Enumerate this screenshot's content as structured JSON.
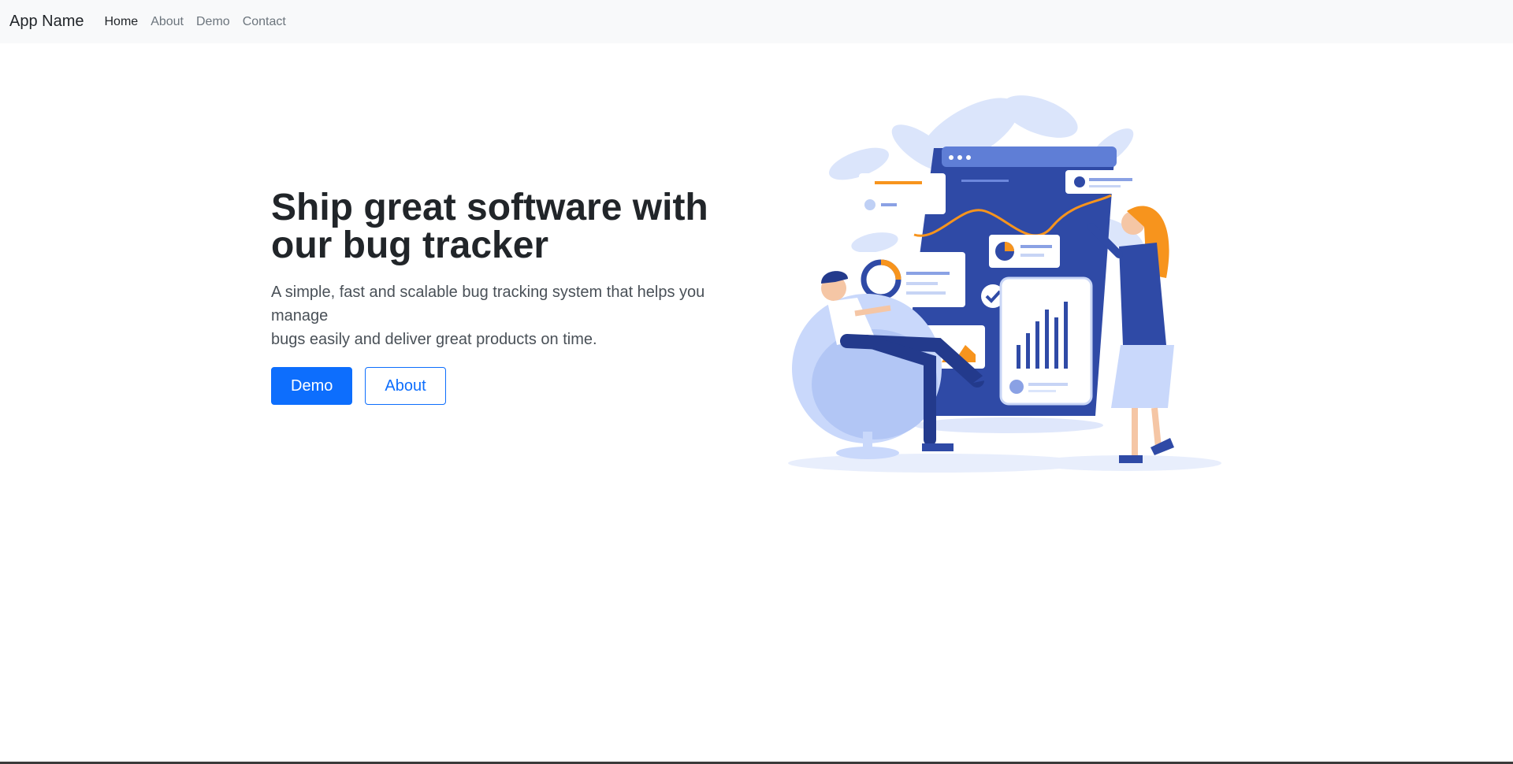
{
  "navbar": {
    "brand": "App Name",
    "links": [
      {
        "label": "Home",
        "active": true
      },
      {
        "label": "About",
        "active": false
      },
      {
        "label": "Demo",
        "active": false
      },
      {
        "label": "Contact",
        "active": false
      }
    ]
  },
  "hero": {
    "title_line1": "Ship great software with",
    "title_line2": "our bug tracker",
    "lead_line1": "A simple, fast and scalable bug tracking system that helps you manage",
    "lead_line2": "bugs easily and deliver great products on time.",
    "primary_button": "Demo",
    "secondary_button": "About"
  },
  "illustration": {
    "icon": "team-analytics-dashboard-illustration"
  },
  "colors": {
    "primary": "#0d6efd",
    "nav_bg": "#f8f9fa",
    "text": "#212529",
    "muted": "#6c757d",
    "illustration_blue": "#2f4aa6",
    "illustration_orange": "#f7941d"
  }
}
